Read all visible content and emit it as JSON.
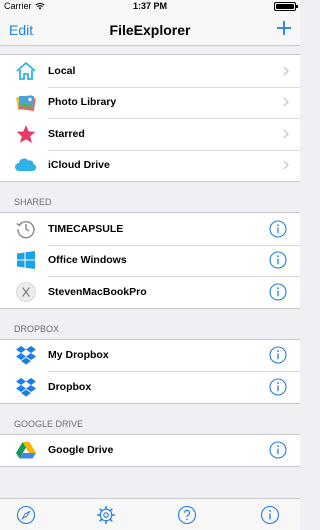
{
  "status": {
    "carrier": "Carrier",
    "time": "1:37 PM"
  },
  "nav": {
    "edit_label": "Edit",
    "title": "FileExplorer"
  },
  "sections": {
    "local_items": [
      {
        "label": "Local",
        "icon": "home-icon"
      },
      {
        "label": "Photo Library",
        "icon": "photo-library-icon"
      },
      {
        "label": "Starred",
        "icon": "star-icon"
      },
      {
        "label": "iCloud Drive",
        "icon": "cloud-icon"
      }
    ],
    "shared": {
      "header": "SHARED",
      "items": [
        {
          "label": "TIMECAPSULE",
          "icon": "time-machine-icon"
        },
        {
          "label": "Office Windows",
          "icon": "windows-icon"
        },
        {
          "label": "StevenMacBookPro",
          "icon": "mac-x-icon"
        }
      ]
    },
    "dropbox": {
      "header": "DROPBOX",
      "items": [
        {
          "label": "My Dropbox",
          "icon": "dropbox-icon"
        },
        {
          "label": "Dropbox",
          "icon": "dropbox-icon"
        }
      ]
    },
    "google_drive": {
      "header": "GOOGLE DRIVE",
      "items": [
        {
          "label": "Google Drive",
          "icon": "google-drive-icon"
        }
      ]
    }
  },
  "tabs": [
    "compass-icon",
    "settings-icon",
    "help-icon",
    "info-icon"
  ],
  "colors": {
    "accent": "#1f7ee6",
    "star": "#e63b66",
    "cloud": "#2fb2e6"
  }
}
